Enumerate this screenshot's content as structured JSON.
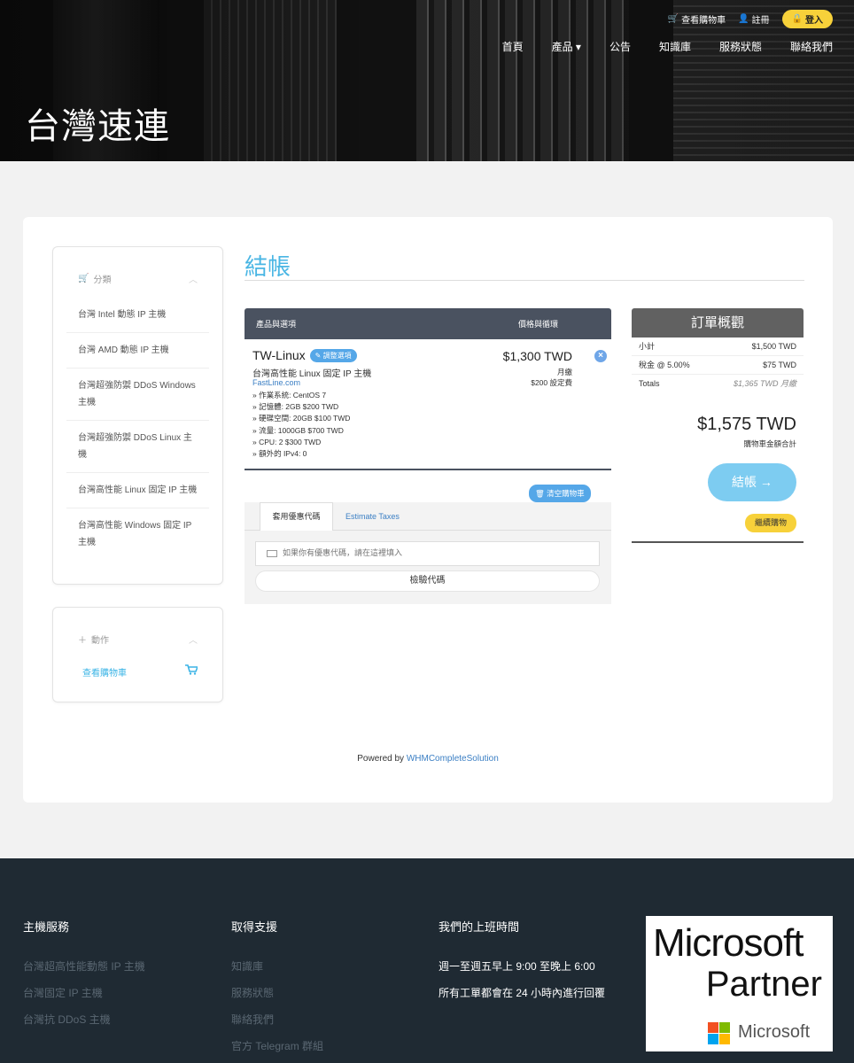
{
  "header": {
    "brand": "台灣速連",
    "topbar": {
      "cart": "查看購物車",
      "register": "註冊",
      "login": "登入"
    },
    "nav": [
      "首頁",
      "產品 ▾",
      "公告",
      "知識庫",
      "服務狀態",
      "聯絡我們"
    ]
  },
  "sidebar": {
    "category_title": "分類",
    "categories": [
      "台灣 Intel 動態 IP 主機",
      "台灣 AMD 動態 IP 主機",
      "台灣超強防禦 DDoS Windows 主機",
      "台灣超強防禦 DDoS Linux 主機",
      "台灣高性能 Linux 固定 IP 主機",
      "台灣高性能 Windows 固定 IP 主機"
    ],
    "actions_title": "動作",
    "view_cart": "查看購物車"
  },
  "checkout": {
    "title": "結帳",
    "table": {
      "col_product": "產品與選項",
      "col_price": "價格與循環"
    },
    "item": {
      "name": "TW-Linux",
      "edit_label": "調整選項",
      "group": "台灣高性能 Linux 固定 IP 主機",
      "domain": "FastLine.com",
      "options": [
        "» 作業系統: CentOS 7",
        "» 記憶體: 2GB $200 TWD",
        "» 硬碟空間: 20GB $100 TWD",
        "» 流量: 1000GB $700 TWD",
        "» CPU: 2 $300 TWD",
        "» 額外的 IPv4: 0"
      ],
      "price": "$1,300 TWD",
      "cycle": "月繳",
      "setup": "$200 設定費"
    },
    "empty_cart": "清空購物車",
    "promo": {
      "tab_coupon": "套用優惠代碼",
      "tab_tax": "Estimate Taxes",
      "placeholder": "如果你有優惠代碼，請在這裡填入",
      "verify": "檢驗代碼"
    }
  },
  "summary": {
    "title": "訂單概觀",
    "subtotal_label": "小計",
    "subtotal": "$1,500 TWD",
    "tax_label": "稅金 @ 5.00%",
    "tax": "$75 TWD",
    "totals_label": "Totals",
    "totals": "$1,365 TWD 月繳",
    "grand_total": "$1,575 TWD",
    "grand_label": "購物車金額合計",
    "checkout": "結帳 →",
    "continue": "繼續購物"
  },
  "powered": {
    "prefix": "Powered by ",
    "link": "WHMCompleteSolution"
  },
  "footer": {
    "col1": {
      "title": "主機服務",
      "links": [
        "台灣超高性能動態 IP 主機",
        "台灣固定 IP 主機",
        "台灣抗 DDoS 主機"
      ]
    },
    "col2": {
      "title": "取得支援",
      "links": [
        "知識庫",
        "服務狀態",
        "聯絡我們",
        "官方 Telegram 群組"
      ]
    },
    "col3": {
      "title": "我們的上班時間",
      "lines": [
        "週一至週五早上 9:00 至晚上 6:00",
        "所有工單都會在 24 小時內進行回覆"
      ]
    },
    "partner": {
      "line1": "Microsoft",
      "line2": "Partner",
      "brand": "Microsoft"
    }
  },
  "colors": {
    "accent": "#4ab6e4",
    "yellow": "#f7d13a",
    "footer_bg": "#1f2a33",
    "table_head": "#4a5260"
  }
}
